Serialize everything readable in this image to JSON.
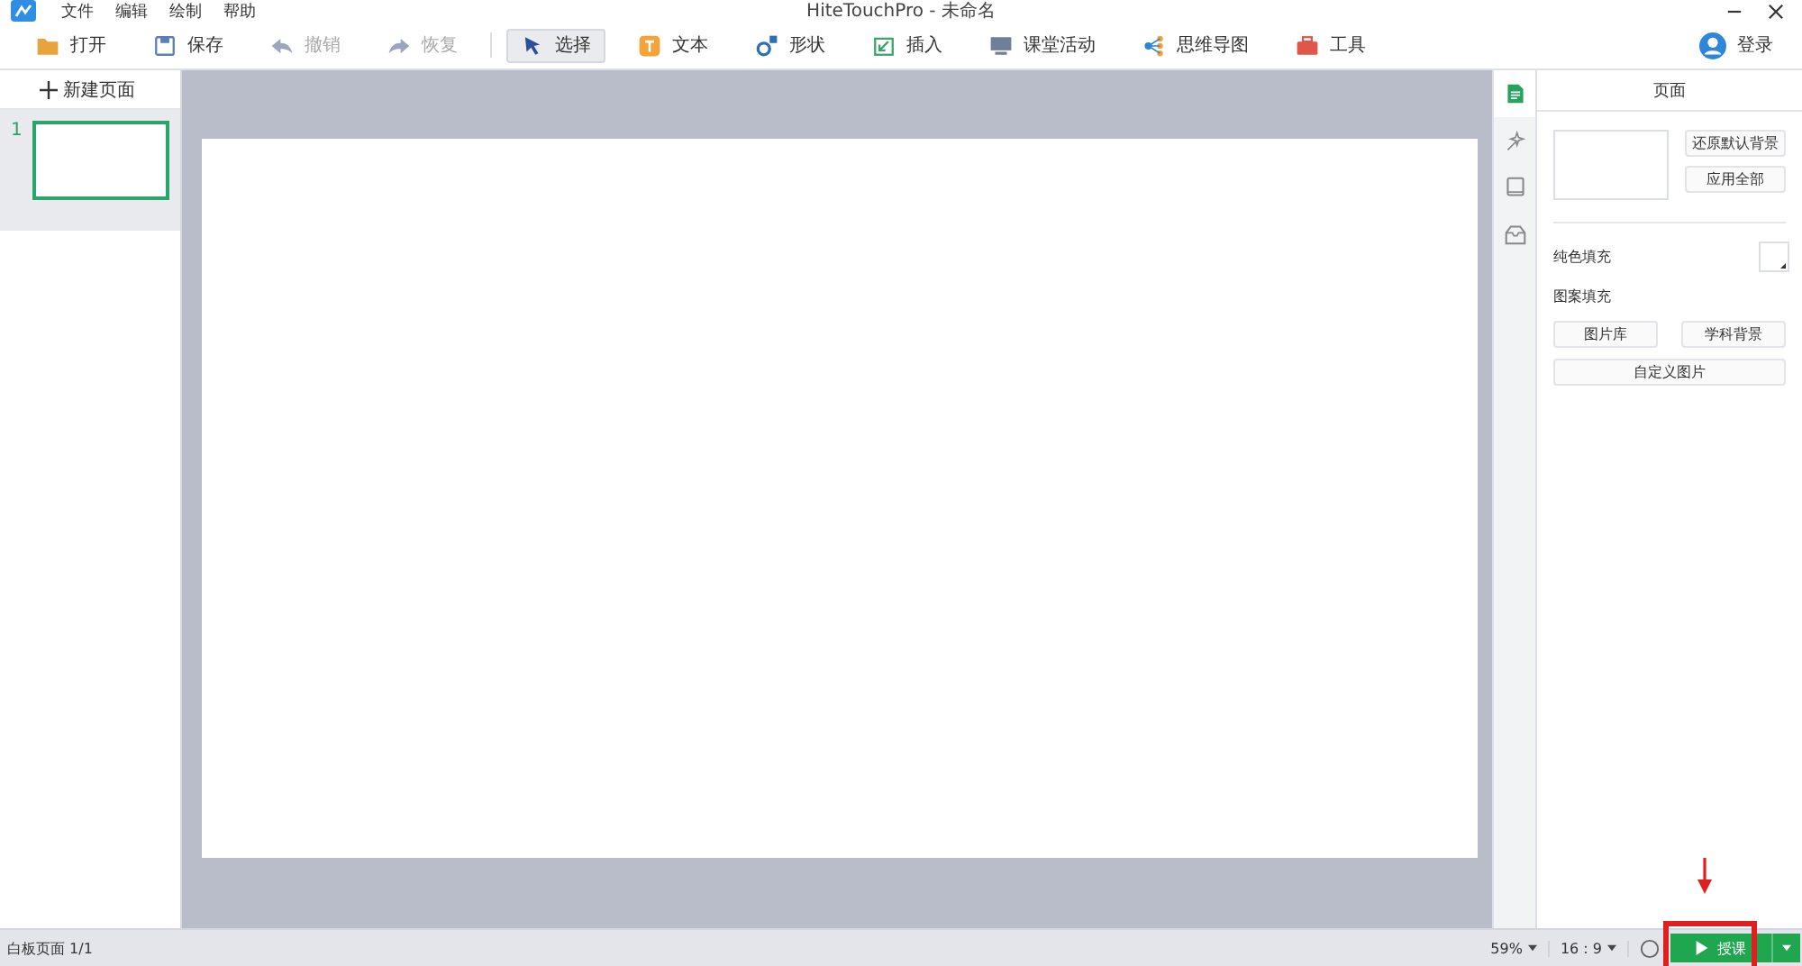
{
  "title_bar": {
    "menus": [
      "文件",
      "编辑",
      "绘制",
      "帮助"
    ],
    "title": "HiteTouchPro - 未命名"
  },
  "toolbar": {
    "items": [
      {
        "label": "打开",
        "disabled": false,
        "selected": false
      },
      {
        "label": "保存",
        "disabled": false,
        "selected": false
      },
      {
        "label": "撤销",
        "disabled": true,
        "selected": false
      },
      {
        "label": "恢复",
        "disabled": true,
        "selected": false
      },
      {
        "label": "选择",
        "disabled": false,
        "selected": true
      },
      {
        "label": "文本",
        "disabled": false,
        "selected": false
      },
      {
        "label": "形状",
        "disabled": false,
        "selected": false
      },
      {
        "label": "插入",
        "disabled": false,
        "selected": false
      },
      {
        "label": "课堂活动",
        "disabled": false,
        "selected": false
      },
      {
        "label": "思维导图",
        "disabled": false,
        "selected": false
      },
      {
        "label": "工具",
        "disabled": false,
        "selected": false
      }
    ],
    "login": "登录"
  },
  "pages_panel": {
    "new_page": "新建页面",
    "pages": [
      {
        "number": "1",
        "selected": true
      }
    ]
  },
  "side_tabs": [
    {
      "selected": true
    },
    {
      "selected": false
    },
    {
      "selected": false
    },
    {
      "selected": false
    }
  ],
  "properties": {
    "title": "页面",
    "restore_button": "还原默认背景",
    "apply_all_button": "应用全部",
    "solid_fill_label": "纯色填充",
    "pattern_fill_label": "图案填充",
    "pattern_buttons": [
      "图片库",
      "学科背景"
    ],
    "custom_image_button": "自定义图片"
  },
  "status_bar": {
    "page_info": "白板页面 1/1",
    "zoom": "59%",
    "ratio": "16 : 9",
    "start_button": "授课"
  }
}
